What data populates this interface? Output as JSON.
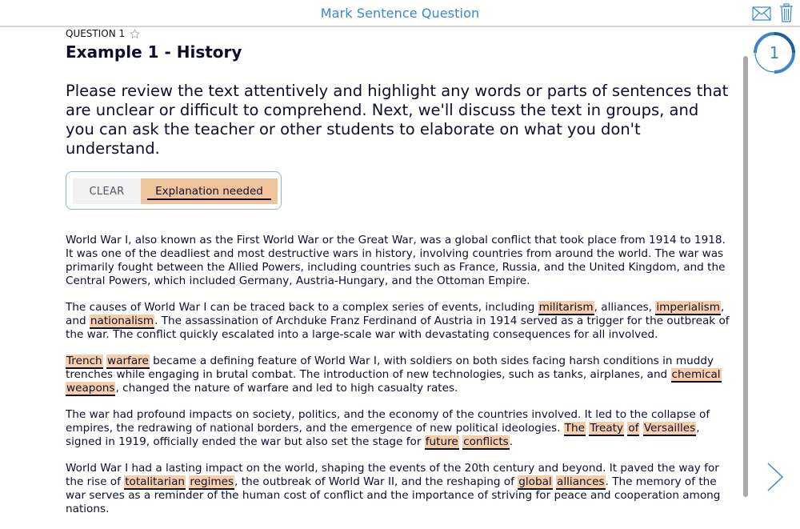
{
  "header": {
    "title": "Mark Sentence Question",
    "icons": [
      "mail-icon",
      "trash-icon"
    ]
  },
  "question": {
    "label": "QUESTION 1",
    "favorite_icon": "star-outline-icon",
    "title": "Example 1 - History",
    "prompt": "Please review the text attentively and highlight any words or parts of sentences that are unclear or difficult to comprehend. Next, we'll discuss the text in groups, and you can ask the teacher or other students to elaborate on what you don't understand."
  },
  "markers": {
    "clear_label": "CLEAR",
    "explain_label": "Explanation needed",
    "selected": "Explanation needed",
    "highlight_color": "#f6ceaa"
  },
  "passage": {
    "p1": {
      "t0": "World War I, also known as the First World War or the Great War, was a global conflict that took place from 1914 to 1918. It was one of the deadliest and most destructive wars in history, involving countries from around the world. The war was primarily fought between the Allied Powers, including countries such as France, Russia, and the United Kingdom, and the Central Powers, which included Germany, Austria-Hungary, and the Ottoman Empire."
    },
    "p2": {
      "t0": "The causes of World War I can be traced back to a complex series of events, including ",
      "h0": "militarism",
      "t1": ", alliances, ",
      "h1": "imperialism",
      "t2": ", and ",
      "h2": "nationalism",
      "t3": ". The assassination of Archduke Franz Ferdinand of Austria in 1914 served as a trigger for the outbreak of the war. The conflict quickly escalated into a large-scale war with devastating consequences for all involved."
    },
    "p3": {
      "h0": "Trench",
      "h1": "warfare",
      "t0": " became a defining feature of World War I, with soldiers on both sides facing harsh conditions in muddy trenches while engaging in brutal combat. The introduction of new technologies, such as tanks, airplanes, and ",
      "h2": "chemical",
      "h3": "weapons",
      "t1": ", changed the nature of warfare and led to high casualty rates."
    },
    "p4": {
      "t0": "The war had profound impacts on society, politics, and the economy of the countries involved. It led to the collapse of empires, the redrawing of national borders, and the emergence of new political ideologies. ",
      "h0": "The",
      "h1": "Treaty",
      "h2": "of",
      "h3": "Versailles",
      "t1": ", signed in 1919, officially ended the war but also set the stage for ",
      "h4": "future",
      "h5": "conflicts",
      "t2": "."
    },
    "p5": {
      "t0": "World War I had a lasting impact on the world, shaping the events of the 20th century and beyond. It paved the way for the rise of ",
      "h0": "totalitarian",
      "h1": "regimes",
      "t1": ", the outbreak of World War II, and the reshaping of ",
      "h2": "global",
      "h3": "alliances",
      "t2": ". The memory of the war serves as a reminder of the human cost of conflict and the importance of striving for peace and cooperation among nations."
    }
  },
  "progress": {
    "question_number": "1",
    "accent_color": "#3a86cc"
  },
  "navigation": {
    "next_icon": "chevron-right-icon"
  }
}
